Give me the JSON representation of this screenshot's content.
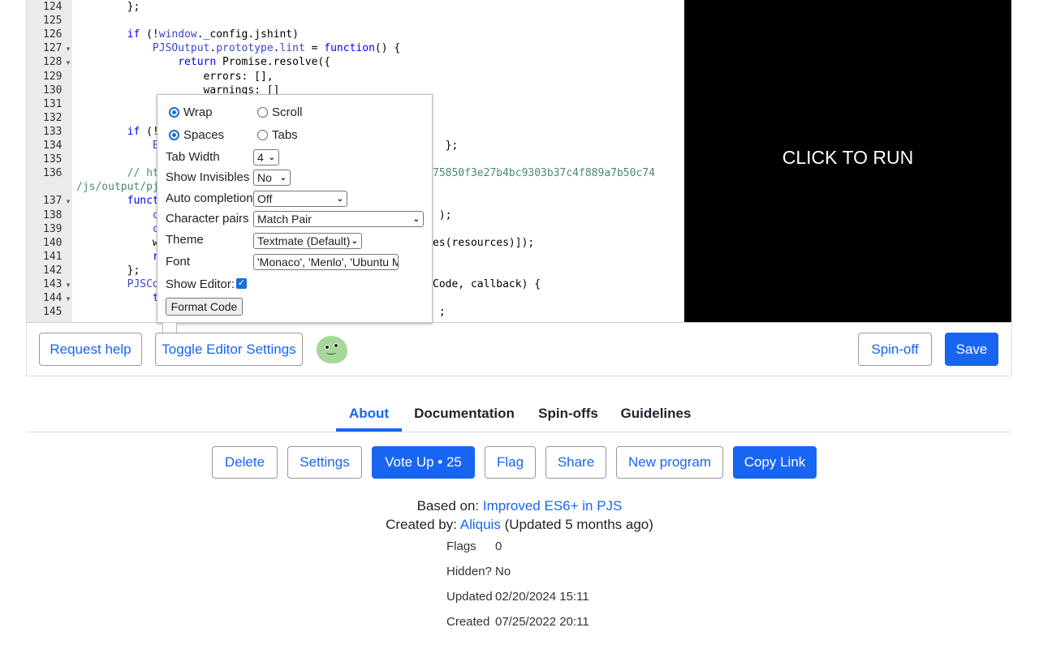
{
  "editor": {
    "lines": [
      {
        "n": "124",
        "fold": false,
        "tokens": [
          [
            "        };",
            ""
          ]
        ]
      },
      {
        "n": "125",
        "fold": false,
        "tokens": []
      },
      {
        "n": "126",
        "fold": false,
        "tokens": [
          [
            "        ",
            ""
          ],
          [
            "if",
            "kw"
          ],
          [
            " (!",
            ""
          ],
          [
            "window",
            "id"
          ],
          [
            "._config.jshint)",
            ""
          ]
        ]
      },
      {
        "n": "127",
        "fold": true,
        "tokens": [
          [
            "            ",
            ""
          ],
          [
            "PJSOutput",
            "id"
          ],
          [
            ".",
            ""
          ],
          [
            "prototype",
            "id"
          ],
          [
            ".",
            ""
          ],
          [
            "lint",
            "id"
          ],
          [
            " = ",
            ""
          ],
          [
            "function",
            "kw"
          ],
          [
            "() {",
            ""
          ]
        ]
      },
      {
        "n": "128",
        "fold": true,
        "tokens": [
          [
            "                ",
            ""
          ],
          [
            "return",
            "kw"
          ],
          [
            " Promise.resolve({",
            ""
          ]
        ]
      },
      {
        "n": "129",
        "fold": false,
        "tokens": [
          [
            "                    errors: [],",
            ""
          ]
        ]
      },
      {
        "n": "130",
        "fold": false,
        "tokens": [
          [
            "                    warnings: []",
            ""
          ]
        ]
      },
      {
        "n": "131",
        "fold": false,
        "tokens": []
      },
      {
        "n": "132",
        "fold": false,
        "tokens": [
          [
            "             }",
            ""
          ]
        ]
      },
      {
        "n": "133",
        "fold": false,
        "tokens": [
          [
            "        ",
            ""
          ],
          [
            "if",
            "kw"
          ],
          [
            " (!",
            ""
          ]
        ]
      },
      {
        "n": "134",
        "fold": false,
        "tokens": [
          [
            "            ",
            ""
          ],
          [
            "E",
            "id"
          ]
        ]
      },
      {
        "n": "135",
        "fold": false,
        "tokens": []
      },
      {
        "n": "136",
        "fold": false,
        "tokens": [
          [
            "        ",
            ""
          ],
          [
            "// ht",
            "cm"
          ]
        ]
      },
      {
        "n": "",
        "fold": false,
        "tokens": [
          [
            "/js/output/pj",
            "cm"
          ]
        ]
      },
      {
        "n": "137",
        "fold": true,
        "tokens": [
          [
            "        ",
            ""
          ],
          [
            "funct",
            "kw"
          ]
        ]
      },
      {
        "n": "138",
        "fold": false,
        "tokens": [
          [
            "            ",
            ""
          ],
          [
            "c",
            "id"
          ]
        ]
      },
      {
        "n": "139",
        "fold": false,
        "tokens": [
          [
            "            ",
            ""
          ],
          [
            "c",
            "id"
          ]
        ]
      },
      {
        "n": "140",
        "fold": false,
        "tokens": [
          [
            "            ",
            ""
          ],
          [
            "w",
            ""
          ]
        ]
      },
      {
        "n": "141",
        "fold": false,
        "tokens": [
          [
            "            ",
            ""
          ],
          [
            "r",
            "kw"
          ]
        ]
      },
      {
        "n": "142",
        "fold": false,
        "tokens": [
          [
            "        };",
            ""
          ]
        ]
      },
      {
        "n": "143",
        "fold": true,
        "tokens": [
          [
            "        ",
            ""
          ],
          [
            "PJSCo",
            "id"
          ]
        ]
      },
      {
        "n": "144",
        "fold": true,
        "tokens": [
          [
            "            ",
            ""
          ],
          [
            "t",
            "kw"
          ]
        ]
      },
      {
        "n": "145",
        "fold": false,
        "tokens": []
      }
    ],
    "right_fragments": [
      {
        "row": 10,
        "text": "  };",
        "cls": ""
      },
      {
        "row": 12,
        "text": "75850f3e27b4bc9303b37c4f889a7b50c74",
        "cls": "cm"
      },
      {
        "row": 15,
        "text": " );",
        "cls": ""
      },
      {
        "row": 17,
        "text": "es(resources)]);",
        "cls": ""
      },
      {
        "row": 20,
        "text": "Code, callback) {",
        "cls": ""
      },
      {
        "row": 22,
        "text": " ;",
        "cls": ""
      }
    ]
  },
  "output": {
    "label": "CLICK TO RUN"
  },
  "settings": {
    "wrap": "Wrap",
    "scroll": "Scroll",
    "spaces": "Spaces",
    "tabs": "Tabs",
    "tab_width_label": "Tab Width",
    "tab_width": "4",
    "invisibles_label": "Show Invisibles",
    "invisibles": "No",
    "autocomplete_label": "Auto completion",
    "autocomplete": "Off",
    "pairs_label": "Character pairs",
    "pairs": "Match Pair",
    "theme_label": "Theme",
    "theme": "Textmate (Default)",
    "font_label": "Font",
    "font": "'Monaco', 'Menlo', 'Ubuntu M",
    "show_editor_label": "Show Editor:",
    "show_editor": true,
    "format_code": "Format Code"
  },
  "toolbar": {
    "request_help": "Request help",
    "toggle_settings": "Toggle Editor Settings",
    "spinoff": "Spin-off",
    "save": "Save"
  },
  "tabs": [
    "About",
    "Documentation",
    "Spin-offs",
    "Guidelines"
  ],
  "actions": {
    "delete": "Delete",
    "settings": "Settings",
    "vote": "Vote Up • 25",
    "flag": "Flag",
    "share": "Share",
    "new_program": "New program",
    "copy_link": "Copy Link"
  },
  "about": {
    "based_on_label": "Based on:",
    "based_on": "Improved ES6+ in PJS",
    "created_by_label": "Created by:",
    "author": "Aliquis",
    "updated_note": "(Updated 5 months ago)",
    "flags_label": "Flags",
    "flags": "0",
    "hidden_label": "Hidden?",
    "hidden": "No",
    "updated_label": "Updated",
    "updated": "02/20/2024 15:11",
    "created_label": "Created",
    "created": "07/25/2022 20:11"
  },
  "colors": {
    "accent": "#1865f2"
  }
}
